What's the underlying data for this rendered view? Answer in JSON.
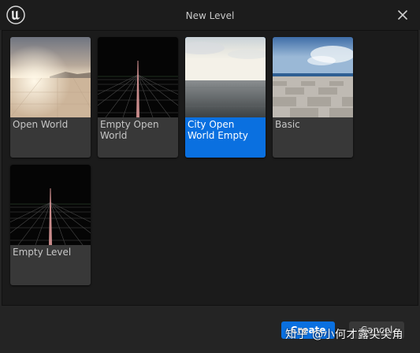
{
  "window": {
    "title": "New Level",
    "logo_icon": "unreal-engine-logo-icon",
    "close_icon": "close-icon"
  },
  "templates": [
    {
      "label": "Open World",
      "thumbnail": "sunset-desert-landscape",
      "selected": false
    },
    {
      "label": "Empty Open World",
      "thumbnail": "empty-grid-horizon",
      "selected": false
    },
    {
      "label": "City Open World Empty",
      "thumbnail": "overcast-ocean-sky",
      "selected": true
    },
    {
      "label": "Basic",
      "thumbnail": "tiled-floor-blue-sky",
      "selected": false
    },
    {
      "label": "Empty Level",
      "thumbnail": "empty-grid-horizon",
      "selected": false
    }
  ],
  "footer": {
    "create_label": "Create",
    "cancel_label": "Cancel"
  },
  "watermark": "知乎 @小何才露尖尖角",
  "colors": {
    "accent": "#0a70e0",
    "tile": "#383838",
    "background": "#242424"
  }
}
